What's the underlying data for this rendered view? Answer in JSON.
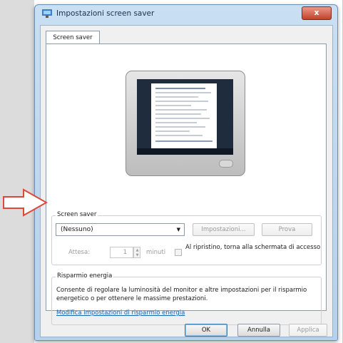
{
  "window": {
    "title": "Impostazioni screen saver",
    "close_label": "x"
  },
  "tab": {
    "label": "Screen saver"
  },
  "screensaver": {
    "group_label": "Screen saver",
    "selected": "(Nessuno)",
    "settings_button": "Impostazioni...",
    "preview_button": "Prova",
    "wait_label": "Attesa:",
    "wait_value": "1",
    "minutes_label": "minuti",
    "resume_label": "Al ripristino, torna alla schermata di accesso"
  },
  "energy": {
    "group_label": "Risparmio energia",
    "description": "Consente di regolare la luminosità del monitor e altre impostazioni per il risparmio energetico o per ottenere le massime prestazioni.",
    "link": "Modifica impostazioni di risparmio energia"
  },
  "footer": {
    "ok_button": "OK",
    "cancel_button": "Annulla",
    "apply_button": "Applica"
  },
  "colors": {
    "arrow": "#e0483b",
    "link": "#1664b4"
  }
}
